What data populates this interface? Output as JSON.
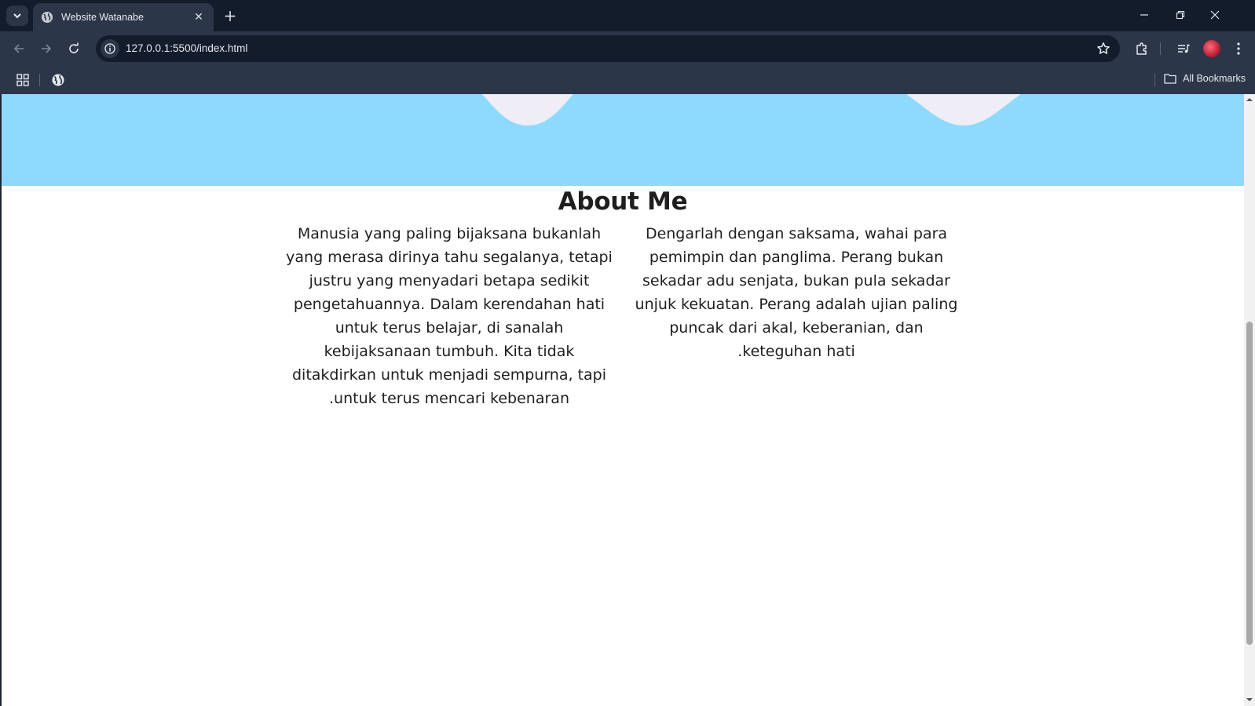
{
  "browser": {
    "tab_title": "Website Watanabe",
    "url": "127.0.0.1:5500/index.html",
    "bookmarks_label": "All Bookmarks",
    "icons": [
      "tab-search-icon",
      "globe-favicon-icon",
      "close-icon",
      "plus-icon",
      "minimize-icon",
      "restore-icon",
      "window-close-icon",
      "back-arrow-icon",
      "forward-arrow-icon",
      "reload-icon",
      "info-icon",
      "star-icon",
      "extensions-icon",
      "media-control-icon",
      "profile-avatar",
      "kebab-menu-icon",
      "apps-grid-icon",
      "folder-icon"
    ]
  },
  "page": {
    "about": {
      "title": "About Me",
      "left_text": "Manusia yang paling bijaksana bukanlah yang merasa dirinya tahu segalanya, tetapi justru yang menyadari betapa sedikit pengetahuannya. Dalam kerendahan hati untuk terus belajar, di sanalah kebijaksanaan tumbuh. Kita tidak ditakdirkan untuk menjadi sempurna, tapi untuk terus mencari kebenaran.",
      "right_text": "Dengarlah dengan saksama, wahai para pemimpin dan panglima. Perang bukan sekadar adu senjata, bukan pula sekadar unjuk kekuatan. Perang adalah ujian paling puncak dari akal, keberanian, dan keteguhan hati."
    },
    "colors": {
      "hero_band": "#8ddafe",
      "drip": "#efedf6",
      "text": "#1e1e1e",
      "browser_frame": "#131c2b",
      "toolbar": "#2b3749"
    }
  }
}
